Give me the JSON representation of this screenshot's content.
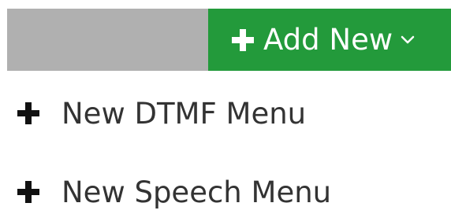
{
  "colors": {
    "accent": "#239a3b",
    "toolbar_gray": "#b0b0b0",
    "menu_text": "#333333"
  },
  "toolbar": {
    "add_new_label": "Add New",
    "add_new_icon": "plus-icon",
    "dropdown_icon": "chevron-down-icon"
  },
  "menu": {
    "items": [
      {
        "label": "New DTMF Menu",
        "icon": "plus-icon"
      },
      {
        "label": "New Speech Menu",
        "icon": "plus-icon"
      }
    ]
  }
}
